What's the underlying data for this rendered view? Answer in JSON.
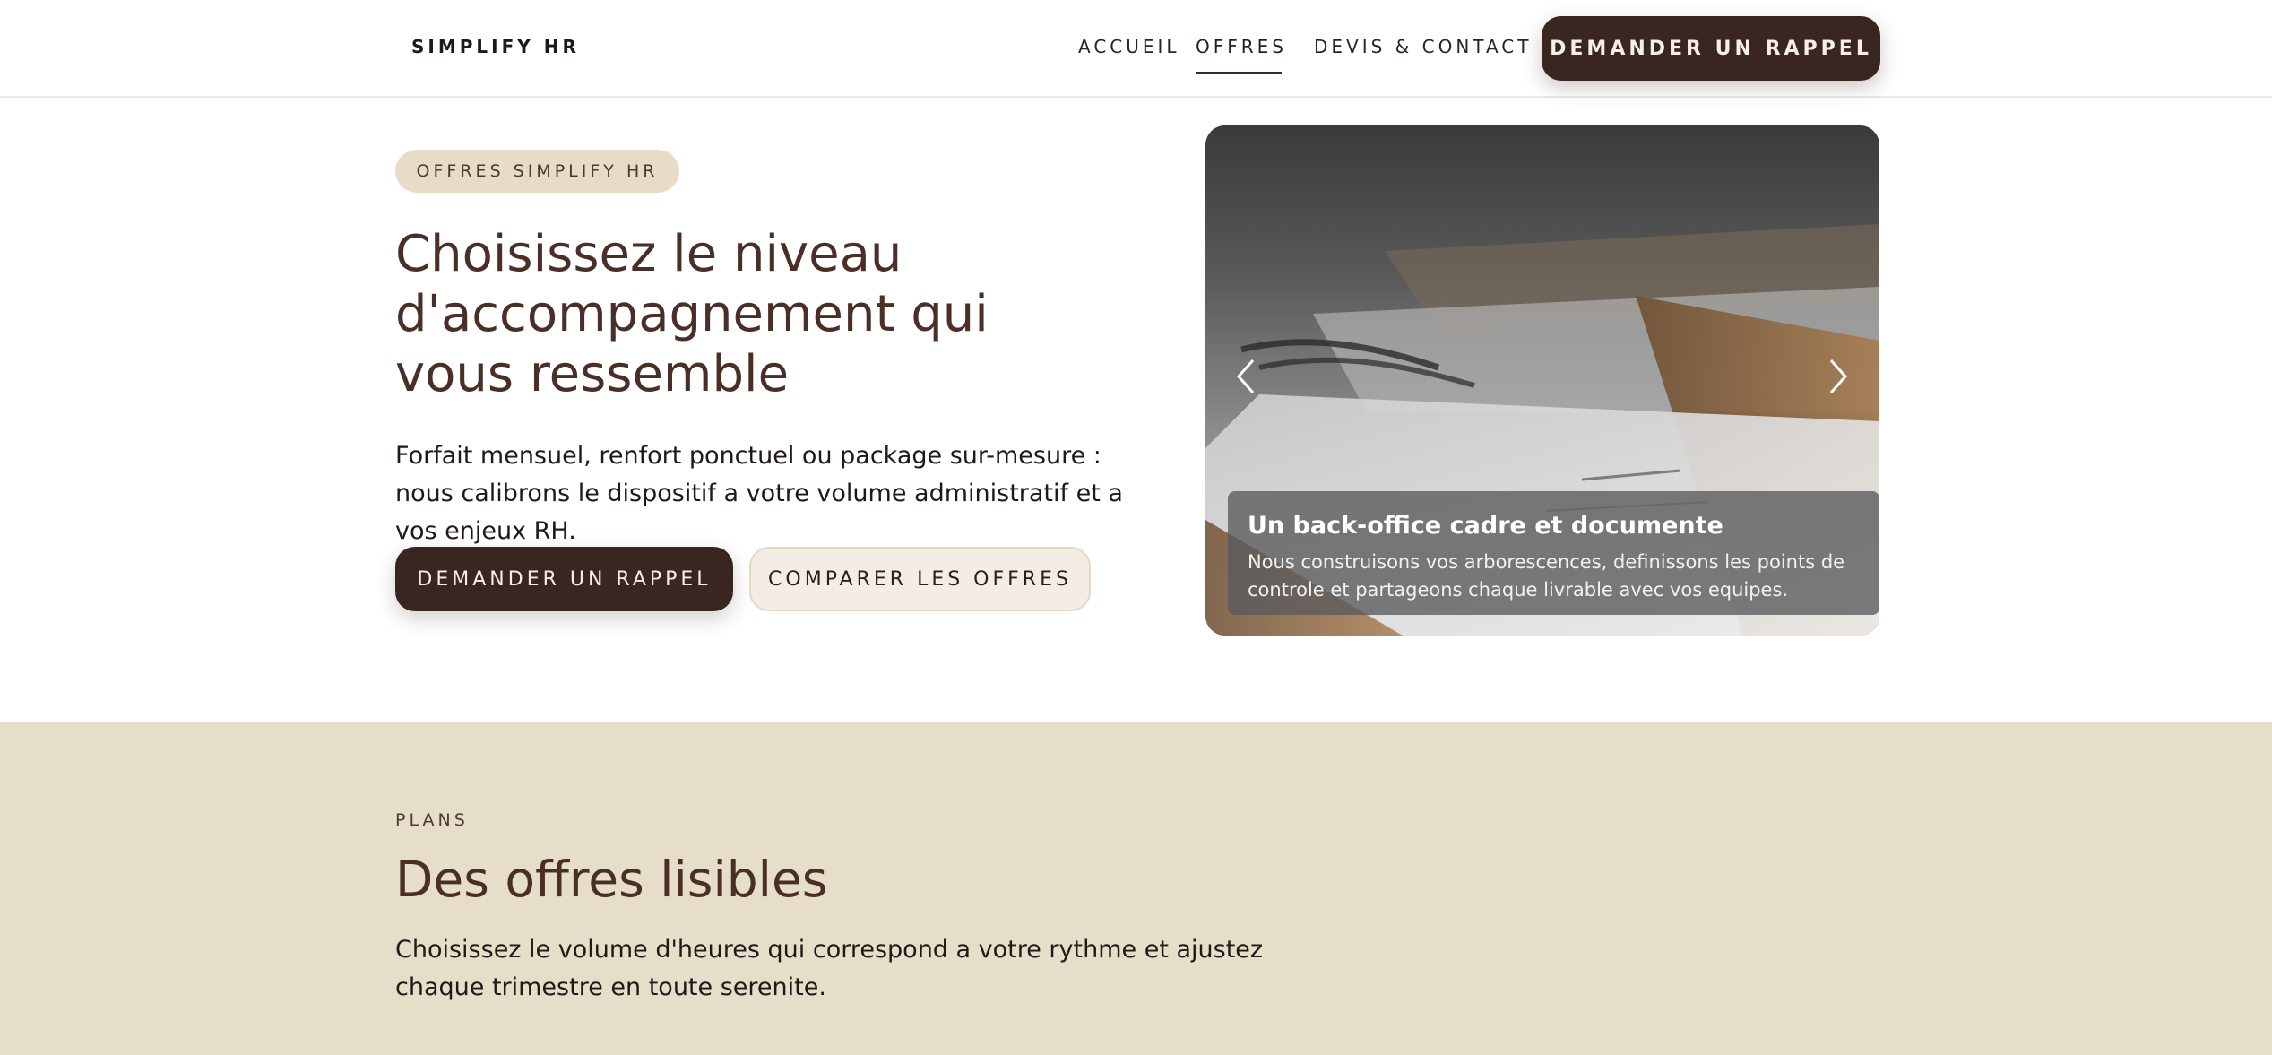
{
  "header": {
    "brand": "SIMPLIFY HR",
    "nav": {
      "accueil": "ACCUEIL",
      "offres": "OFFRES",
      "devis": "DEVIS & CONTACT"
    },
    "cta": "DEMANDER UN RAPPEL"
  },
  "hero": {
    "pill": "OFFRES SIMPLIFY HR",
    "title": "Choisissez le niveau d'accompagnement qui vous ressemble",
    "lead": "Forfait mensuel, renfort ponctuel ou package sur-mesure : nous calibrons le dispositif a votre volume administratif et a vos enjeux RH.",
    "primary_button": "DEMANDER UN RAPPEL",
    "secondary_button": "COMPARER LES OFFRES"
  },
  "carousel": {
    "caption_title": "Un back-office cadre et documente",
    "caption_text": "Nous construisons vos arborescences, definissons les points de controle et partageons chaque livrable avec vos equipes.",
    "prev_icon": "chevron-left-icon",
    "next_icon": "chevron-right-icon"
  },
  "plans": {
    "eyebrow": "PLANS",
    "title": "Des offres lisibles",
    "lead": "Choisissez le volume d'heures qui correspond a votre rythme et ajustez chaque trimestre en toute serenite."
  },
  "colors": {
    "brand_dark": "#3a2620",
    "heading": "#4a2f27",
    "sand": "#e7dec9",
    "pill": "#e8dcc6"
  }
}
